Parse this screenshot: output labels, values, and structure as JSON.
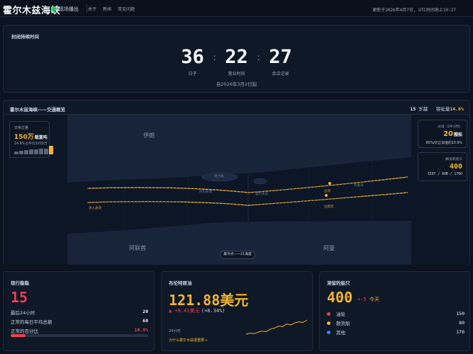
{
  "header": {
    "brand": "霍尔木兹海峡",
    "live_label": "现场播出",
    "nav": [
      "关于",
      "新闻",
      "常见问题"
    ],
    "updated": "更新于2026年4月7日, UTC时间地上10:27"
  },
  "countdown": {
    "title": "封闭持续时间",
    "days": "36",
    "days_label": "日子",
    "hours": "22",
    "hours_label": "营业时间",
    "minutes": "27",
    "minutes_label": "会议记录",
    "since": "自2026年3月2日起"
  },
  "map": {
    "title": "霍尔木兹海峡——交通概览",
    "transit_count": "15",
    "transit_label": "岁越",
    "capacity_label": "容祉量",
    "capacity_value": "14.6%",
    "traffic_card": {
      "title": "日常过量",
      "value": "150万",
      "unit": "载重吨",
      "sub": "14.6%占平均1030万",
      "bars": [
        0.35,
        0.4,
        0.5,
        0.55,
        0.6,
        0.65,
        0.7,
        1.0
      ]
    },
    "transit_card": {
      "title": "过境（24小时）",
      "value": "20",
      "unit": "艘船",
      "sub": "60%/灾正常值的10.9%"
    },
    "tanker_card": {
      "title": "搁浅的船只",
      "value": "400",
      "sub": "150T / 80B / 170O"
    },
    "labels": {
      "iran": "伊朗",
      "uae": "阿联酋",
      "oman": "阿曼",
      "inbound": "进入通道",
      "outbound": "出境",
      "strait": "阿曼湾",
      "island1": "格什姆",
      "island2": "霍尔木兹",
      "island3": "拉腊克",
      "bandar": "阿巴斯港"
    },
    "scale_label": "最窄点——21海里"
  },
  "days_panel": {
    "title": "现行稳稳",
    "value": "15",
    "row1_label": "最后24小时",
    "row1_value": "20",
    "row2_label": "正常的每日平均总额",
    "row2_value": "60",
    "row3_label": "正常的百分比",
    "row3_value": "10.9%",
    "progress": 0.109
  },
  "oil_panel": {
    "title": "布伦特原油",
    "value": "121.88美元",
    "change": "▲ +8.41美元",
    "change_pct": "(+8.34%)",
    "range_label": "24小时",
    "link": "为什么霍尔木兹很重要→",
    "spark": [
      108,
      109,
      108.5,
      110,
      111,
      110.5,
      113,
      114,
      116,
      115.5,
      118,
      117,
      119,
      120,
      119.5,
      121.88
    ]
  },
  "ships_panel": {
    "title": "滞留的船只",
    "value": "400",
    "change_prefix": "+-5",
    "change_suffix": "今天",
    "rows": [
      {
        "label": "油轮",
        "value": "150",
        "color": "#ef3e4f"
      },
      {
        "label": "散货船",
        "value": "80",
        "color": "#f5b52c"
      },
      {
        "label": "其他",
        "value": "170",
        "color": "#3b82f6"
      }
    ]
  }
}
